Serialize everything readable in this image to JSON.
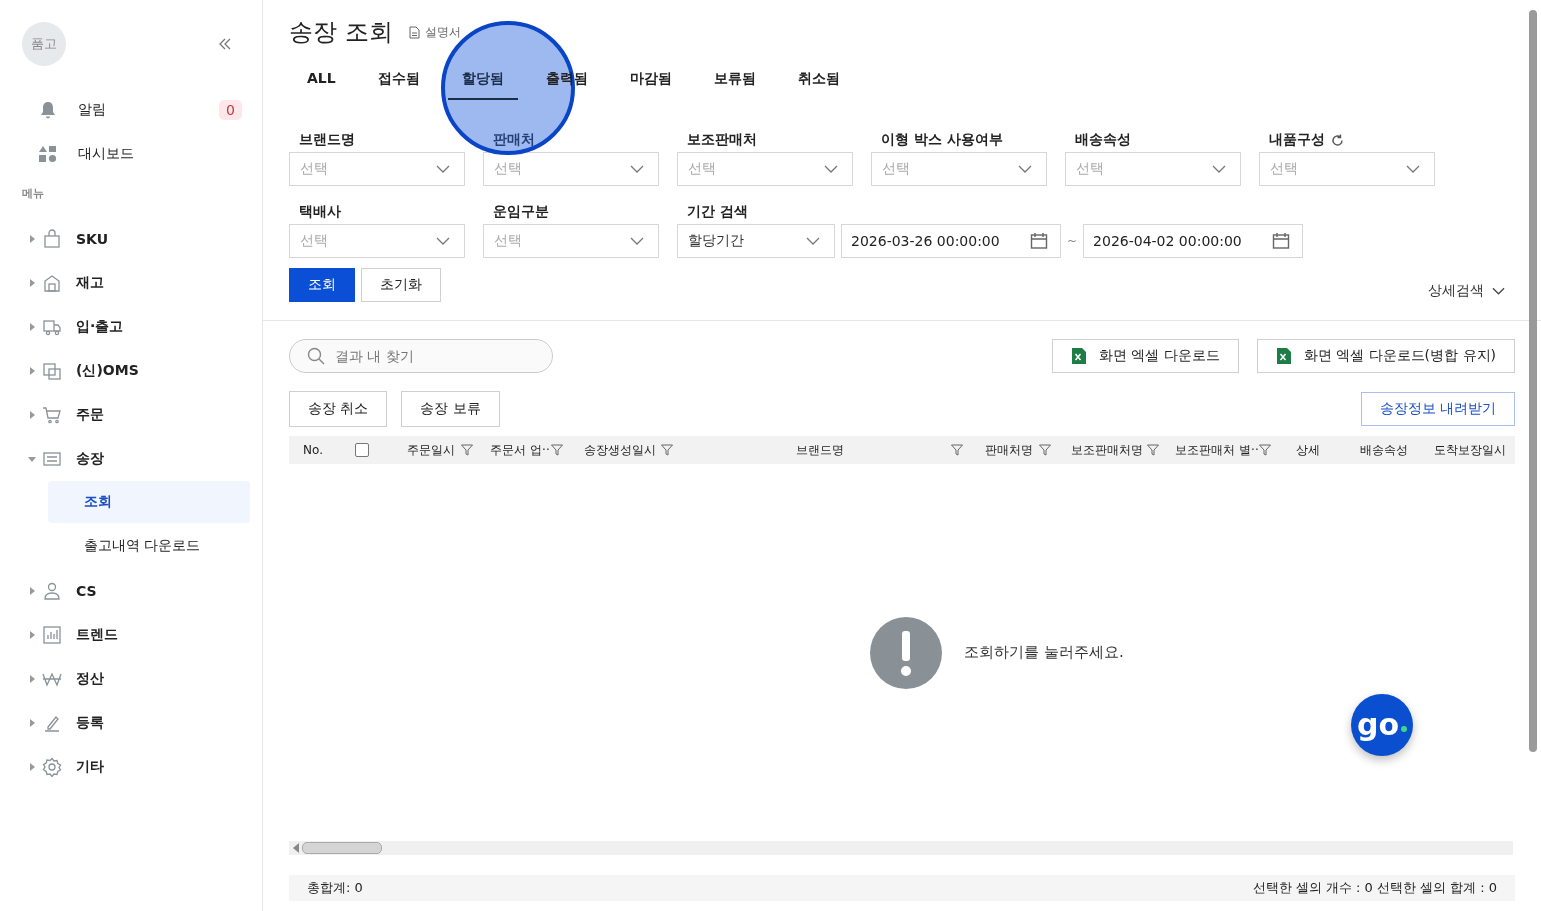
{
  "sidebar": {
    "avatar": "품고",
    "top_items": [
      {
        "label": "알림",
        "badge": "0"
      },
      {
        "label": "대시보드"
      }
    ],
    "section_title": "메뉴",
    "menu": [
      {
        "label": "SKU",
        "expanded": false
      },
      {
        "label": "재고",
        "expanded": false
      },
      {
        "label": "입·출고",
        "expanded": false
      },
      {
        "label": "(신)OMS",
        "expanded": false
      },
      {
        "label": "주문",
        "expanded": false
      },
      {
        "label": "송장",
        "expanded": true,
        "children": [
          {
            "label": "조회",
            "selected": true
          },
          {
            "label": "출고내역 다운로드",
            "selected": false
          }
        ]
      },
      {
        "label": "CS",
        "expanded": false
      },
      {
        "label": "트렌드",
        "expanded": false
      },
      {
        "label": "정산",
        "expanded": false
      },
      {
        "label": "등록",
        "expanded": false
      },
      {
        "label": "기타",
        "expanded": false
      }
    ]
  },
  "page": {
    "title": "송장 조회",
    "manual_link": "설명서"
  },
  "tabs": [
    {
      "label": "ALL",
      "selected": false
    },
    {
      "label": "접수됨",
      "selected": false
    },
    {
      "label": "할당됨",
      "selected": true
    },
    {
      "label": "출력됨",
      "selected": false
    },
    {
      "label": "마감됨",
      "selected": false
    },
    {
      "label": "보류됨",
      "selected": false
    },
    {
      "label": "취소됨",
      "selected": false
    }
  ],
  "filters": [
    {
      "label": "브랜드명",
      "placeholder": "선택",
      "refresh": false
    },
    {
      "label": "판매처",
      "placeholder": "선택",
      "refresh": false
    },
    {
      "label": "보조판매처",
      "placeholder": "선택",
      "refresh": false
    },
    {
      "label": "이형 박스 사용여부",
      "placeholder": "선택",
      "refresh": false
    },
    {
      "label": "배송속성",
      "placeholder": "선택",
      "refresh": false
    },
    {
      "label": "내품구성",
      "placeholder": "선택",
      "refresh": true
    },
    {
      "label": "택배사",
      "placeholder": "선택",
      "refresh": false
    },
    {
      "label": "운임구분",
      "placeholder": "선택",
      "refresh": false
    }
  ],
  "period": {
    "label": "기간 검색",
    "type_value": "할당기간",
    "from": "2026-03-26 00:00:00",
    "separator": "~",
    "to": "2026-04-02 00:00:00"
  },
  "search_button": "조회",
  "reset_button": "초기화",
  "advanced_toggle": "상세검색",
  "result_search": {
    "placeholder": "결과 내 찾기"
  },
  "excel_buttons": [
    "화면 엑셀 다운로드",
    "화면 엑셀 다운로드(병합 유지)"
  ],
  "action_buttons": [
    "송장 취소",
    "송장 보류"
  ],
  "download_button": "송장정보 내려받기",
  "table": {
    "columns": [
      {
        "kind": "text",
        "label": "No.",
        "filter": false
      },
      {
        "kind": "checkbox",
        "checked": false,
        "filter": false
      },
      {
        "kind": "text",
        "label": "주문일시",
        "filter": true
      },
      {
        "kind": "text",
        "label": "주문서 업··",
        "filter": true
      },
      {
        "kind": "text",
        "label": "송장생성일시",
        "filter": true
      },
      {
        "kind": "text",
        "label": "브랜드명",
        "filter": true
      },
      {
        "kind": "text",
        "label": "판매처명",
        "filter": true
      },
      {
        "kind": "text",
        "label": "보조판매처명",
        "filter": true
      },
      {
        "kind": "text",
        "label": "보조판매처 별··",
        "filter": true
      },
      {
        "kind": "text",
        "label": "상세",
        "filter": false
      },
      {
        "kind": "text",
        "label": "배송속성",
        "filter": false
      },
      {
        "kind": "text",
        "label": "도착보장일시",
        "filter": false
      }
    ],
    "empty_message": "조회하기를 눌러주세요."
  },
  "footer": {
    "total": "총합계: 0",
    "selection": "선택한 셀의 개수 : 0  선택한 셀의 합계 : 0"
  },
  "chat_button": "go"
}
